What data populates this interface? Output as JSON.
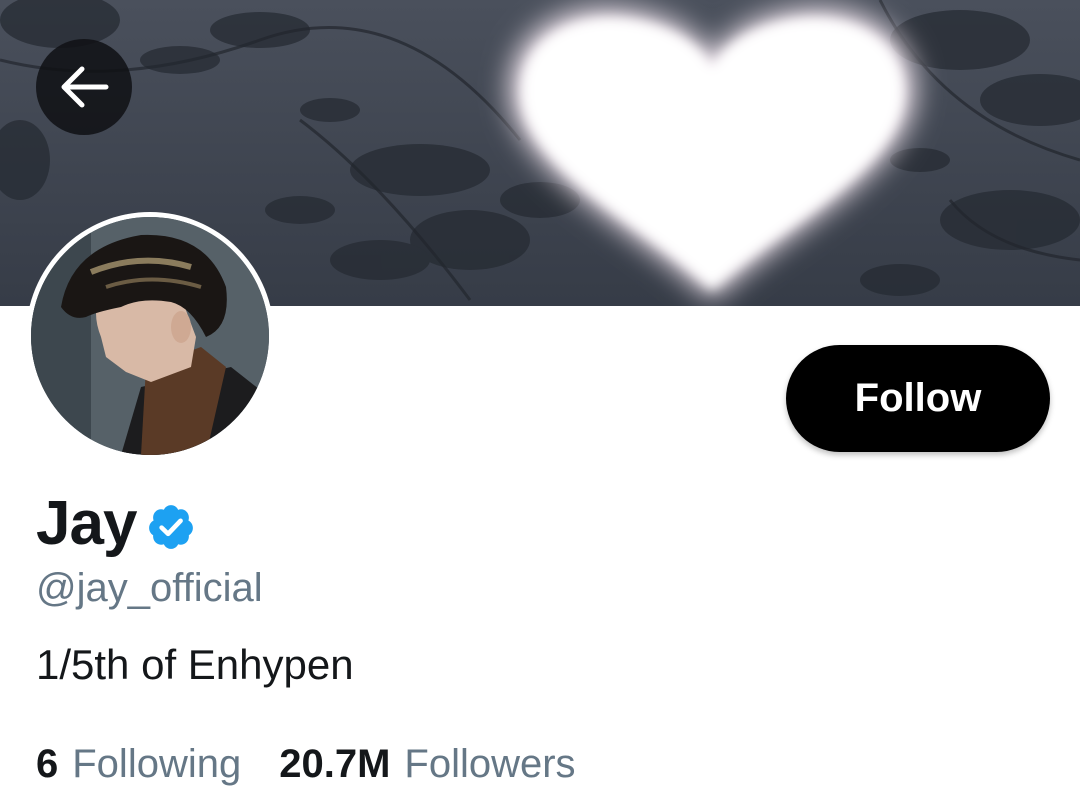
{
  "header": {
    "back_icon": "arrow-left-icon"
  },
  "profile": {
    "display_name": "Jay",
    "verified_icon": "verified-badge-icon",
    "verified_color": "#1da1f2",
    "handle": "@jay_official",
    "bio": "1/5th of Enhypen",
    "follow_label": "Follow"
  },
  "stats": {
    "following_count": "6",
    "following_label": "Following",
    "followers_count": "20.7M",
    "followers_label": "Followers"
  }
}
